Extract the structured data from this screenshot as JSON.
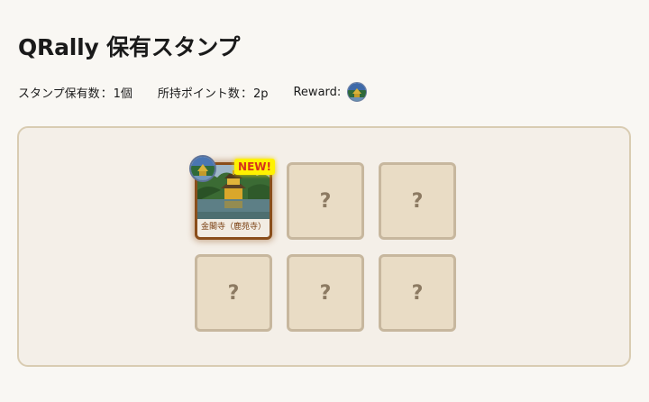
{
  "page": {
    "title": "QRally 保有スタンプ"
  },
  "stats": {
    "stamp_count_label": "スタンプ保有数",
    "stamp_count_value": "1個",
    "points_label": "所持ポイント数",
    "points_value": "2p",
    "reward_label": "Reward:",
    "reward_icon": "temple-badge-icon"
  },
  "stamps": [
    {
      "collected": true,
      "caption": "金閣寺（鹿苑寺）",
      "badge": "NEW!",
      "image": "kinkakuji-photo"
    },
    {
      "collected": false,
      "placeholder": "?"
    },
    {
      "collected": false,
      "placeholder": "?"
    },
    {
      "collected": false,
      "placeholder": "?"
    },
    {
      "collected": false,
      "placeholder": "?"
    },
    {
      "collected": false,
      "placeholder": "?"
    }
  ],
  "colors": {
    "background": "#f9f7f3",
    "panel_border": "#d9ccb2",
    "slot_fill": "#e9dcc5",
    "stamp_border": "#8a4e1b",
    "new_badge": "#fff200",
    "new_text": "#d6321c"
  }
}
